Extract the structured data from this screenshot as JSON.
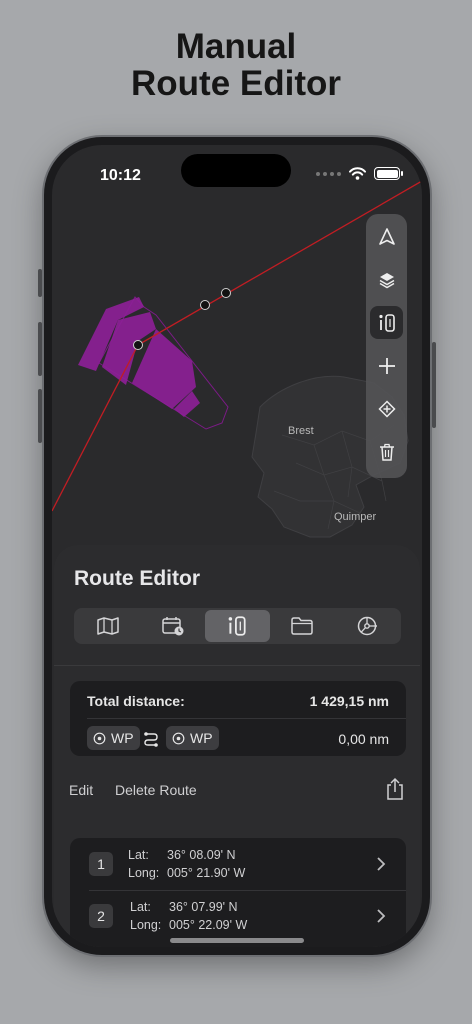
{
  "headline": {
    "line1": "Manual",
    "line2": "Route Editor"
  },
  "status_bar": {
    "time": "10:12"
  },
  "map": {
    "cities": [
      "Brest",
      "Quimper"
    ]
  },
  "map_toolbar": {
    "tools": [
      {
        "name": "navigate",
        "icon": "location-arrow-icon",
        "active": false
      },
      {
        "name": "layers",
        "icon": "layers-icon",
        "active": false
      },
      {
        "name": "route-editor",
        "icon": "route-ruler-icon",
        "active": true
      },
      {
        "name": "zoom-in",
        "icon": "plus-icon",
        "active": false
      },
      {
        "name": "add-waypoint",
        "icon": "add-waypoint-icon",
        "active": false
      },
      {
        "name": "delete",
        "icon": "trash-icon",
        "active": false
      }
    ]
  },
  "sheet": {
    "title": "Route Editor",
    "tabs": [
      {
        "icon": "map-icon",
        "active": false
      },
      {
        "icon": "calendar-clock-icon",
        "active": false
      },
      {
        "icon": "route-ruler-icon",
        "active": true
      },
      {
        "icon": "folder-icon",
        "active": false
      },
      {
        "icon": "steering-wheel-icon",
        "active": false
      }
    ],
    "distance": {
      "label": "Total distance:",
      "value": "1 429,15 nm"
    },
    "leg": {
      "from": "WP",
      "to": "WP",
      "value": "0,00 nm"
    },
    "actions": {
      "edit": "Edit",
      "delete_route": "Delete Route"
    },
    "waypoints": [
      {
        "index": "1",
        "lat_label": "Lat:",
        "lat": "36° 08.09' N",
        "long_label": "Long:",
        "long": "005° 21.90' W"
      },
      {
        "index": "2",
        "lat_label": "Lat:",
        "lat": "36° 07.99' N",
        "long_label": "Long:",
        "long": "005° 22.09' W"
      }
    ]
  },
  "colors": {
    "route": "#c11d23",
    "zone": "#8e1f98",
    "background": "#a6a8ab",
    "sheet": "#2c2c2e"
  }
}
